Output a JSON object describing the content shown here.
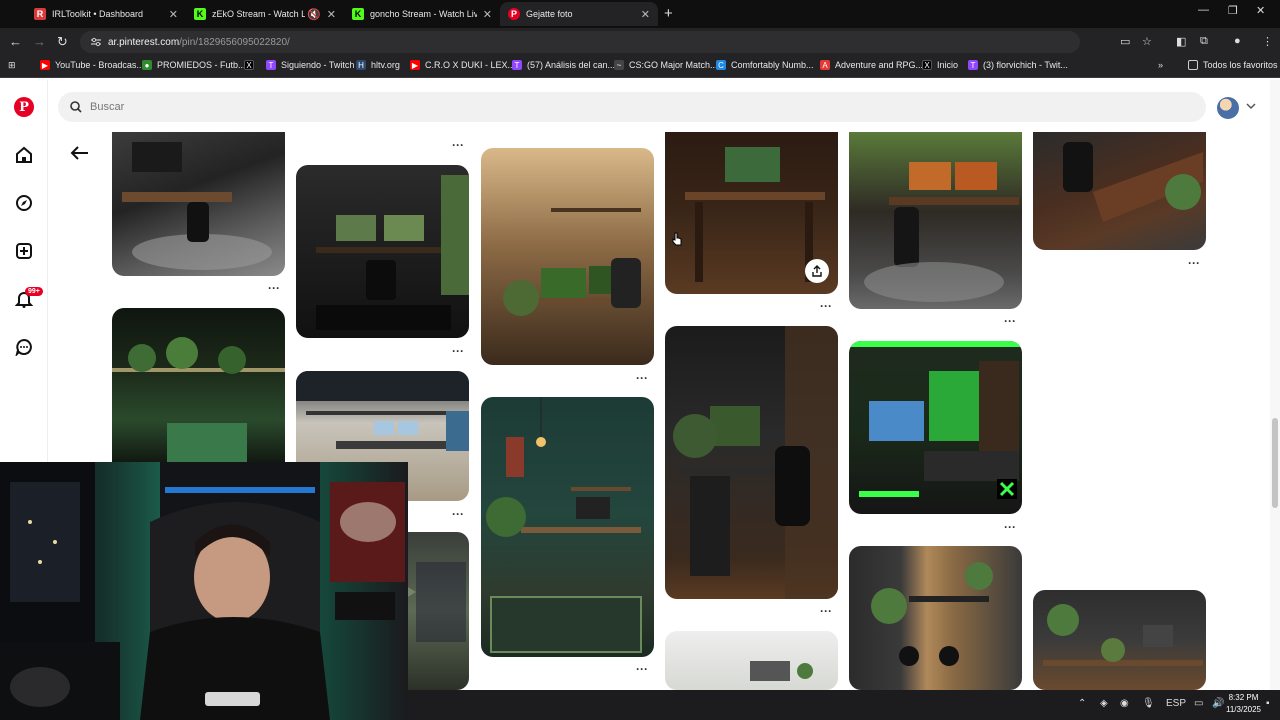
{
  "browser": {
    "tabs": [
      {
        "title": "IRLToolkit • Dashboard",
        "icon": "irltoolkit-icon",
        "color": "#d93a3a"
      },
      {
        "title": "zEkO Stream - Watch Live o",
        "icon": "kick-icon",
        "color": "#53fc18"
      },
      {
        "title": "goncho Stream - Watch Live or",
        "icon": "kick-icon",
        "color": "#53fc18"
      },
      {
        "title": "Gejatte foto",
        "icon": "pinterest-icon",
        "color": "#e60023"
      }
    ],
    "url_host": "ar.pinterest.com",
    "url_path": "/pin/1829656095022820/",
    "bookmarks": [
      {
        "label": "YouTube - Broadcas...",
        "color": "#ff0000",
        "glyph": "▶"
      },
      {
        "label": "PROMIEDOS - Futb...",
        "color": "#2e8b2e",
        "glyph": "●"
      },
      {
        "label": "",
        "color": "#000000",
        "glyph": "X"
      },
      {
        "label": "Siguiendo - Twitch",
        "color": "#9146ff",
        "glyph": "T"
      },
      {
        "label": "hltv.org",
        "color": "#2b4a6f",
        "glyph": "H"
      },
      {
        "label": "C.R.O X DUKI - LEX...",
        "color": "#ff0000",
        "glyph": "▶"
      },
      {
        "label": "(57) Análisis del can...",
        "color": "#9146ff",
        "glyph": "T"
      },
      {
        "label": "CS:GO Major Match...",
        "color": "#444444",
        "glyph": "~"
      },
      {
        "label": "Comfortably Numb...",
        "color": "#1e88e5",
        "glyph": "C"
      },
      {
        "label": "Adventure and RPG...",
        "color": "#e53935",
        "glyph": "A"
      },
      {
        "label": "Inicio",
        "color": "#000000",
        "glyph": "X"
      },
      {
        "label": "(3) florvichich - Twit...",
        "color": "#9146ff",
        "glyph": "T"
      }
    ],
    "all_bookmarks": "Todos los favoritos"
  },
  "pinterest": {
    "search_placeholder": "Buscar",
    "notification_badge": "99+",
    "brand_color": "#e60023"
  },
  "taskbar": {
    "lang": "ESP",
    "time": "8:32 PM",
    "date": "11/3/2025"
  }
}
